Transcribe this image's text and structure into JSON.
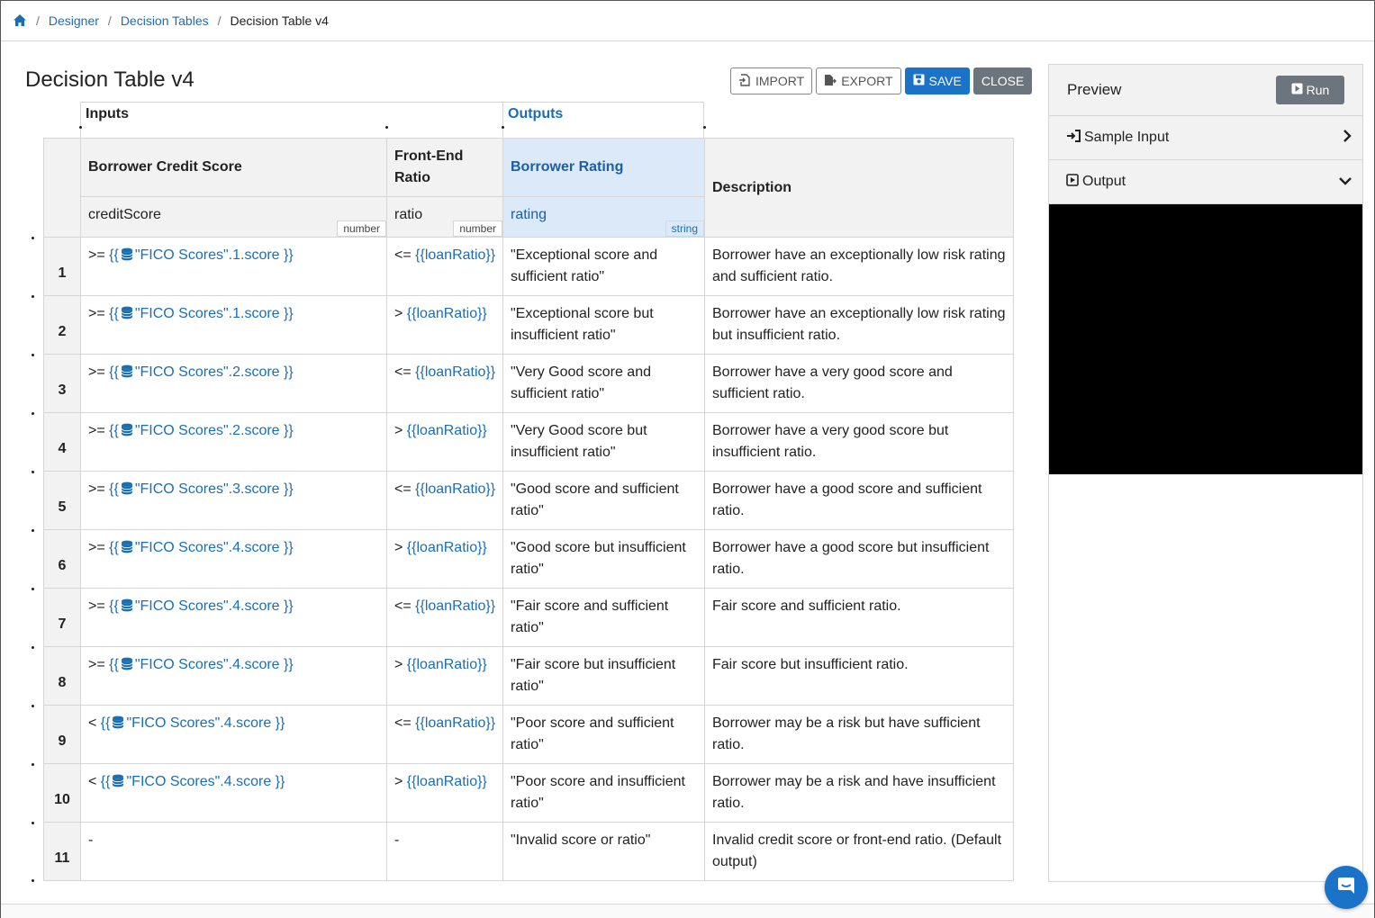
{
  "breadcrumb": {
    "items": [
      {
        "label": "Designer"
      },
      {
        "label": "Decision Tables"
      }
    ],
    "current": "Decision Table v4"
  },
  "page_title": "Decision Table v4",
  "toolbar": {
    "import_label": "IMPORT",
    "export_label": "EXPORT",
    "save_label": "SAVE",
    "close_label": "CLOSE"
  },
  "table": {
    "inputs_label": "Inputs",
    "outputs_label": "Outputs",
    "columns": [
      {
        "name": "Borrower Credit Score",
        "variable": "creditScore",
        "type": "number"
      },
      {
        "name": "Front-End Ratio",
        "variable": "ratio",
        "type": "number"
      },
      {
        "name": "Borrower Rating",
        "variable": "rating",
        "type": "string"
      }
    ],
    "description_label": "Description",
    "rows": [
      {
        "num": "1",
        "op1": ">= ",
        "ref1_open": "{{",
        "ref1_text": "\"FICO Scores\".1.score }}",
        "op2": "<= ",
        "ref2": "{{loanRatio}}",
        "rating": "\"Exceptional score and sufficient ratio\"",
        "desc": "Borrower have an exceptionally low risk rating and sufficient ratio."
      },
      {
        "num": "2",
        "op1": ">= ",
        "ref1_open": "{{",
        "ref1_text": "\"FICO Scores\".1.score }}",
        "op2": "> ",
        "ref2": "{{loanRatio}}",
        "rating": "\"Exceptional score but insufficient ratio\"",
        "desc": "Borrower have an exceptionally low risk rating but insufficient ratio."
      },
      {
        "num": "3",
        "op1": ">= ",
        "ref1_open": "{{",
        "ref1_text": "\"FICO Scores\".2.score }}",
        "op2": "<= ",
        "ref2": "{{loanRatio}}",
        "rating": "\"Very Good score and sufficient ratio\"",
        "desc": "Borrower have a very good score and sufficient ratio."
      },
      {
        "num": "4",
        "op1": ">= ",
        "ref1_open": "{{",
        "ref1_text": "\"FICO Scores\".2.score }}",
        "op2": "> ",
        "ref2": "{{loanRatio}}",
        "rating": "\"Very Good score but insufficient ratio\"",
        "desc": "Borrower have a very good score but insufficient ratio."
      },
      {
        "num": "5",
        "op1": ">= ",
        "ref1_open": "{{",
        "ref1_text": "\"FICO Scores\".3.score }}",
        "op2": "<= ",
        "ref2": "{{loanRatio}}",
        "rating": "\"Good score and sufficient ratio\"",
        "desc": "Borrower have a good score and sufficient ratio."
      },
      {
        "num": "6",
        "op1": ">= ",
        "ref1_open": "{{",
        "ref1_text": "\"FICO Scores\".4.score }}",
        "op2": "> ",
        "ref2": "{{loanRatio}}",
        "rating": "\"Good score but insufficient ratio\"",
        "desc": "Borrower have a good score but insufficient ratio."
      },
      {
        "num": "7",
        "op1": ">= ",
        "ref1_open": "{{",
        "ref1_text": "\"FICO Scores\".4.score }}",
        "op2": "<= ",
        "ref2": "{{loanRatio}}",
        "rating": "\"Fair score and sufficient ratio\"",
        "desc": "Fair score and sufficient ratio."
      },
      {
        "num": "8",
        "op1": ">= ",
        "ref1_open": "{{",
        "ref1_text": "\"FICO Scores\".4.score }}",
        "op2": "> ",
        "ref2": "{{loanRatio}}",
        "rating": "\"Fair score but insufficient ratio\"",
        "desc": "Fair score but insufficient ratio."
      },
      {
        "num": "9",
        "op1": "< ",
        "ref1_open": "{{",
        "ref1_text": "\"FICO Scores\".4.score }}",
        "op2": "<= ",
        "ref2": "{{loanRatio}}",
        "rating": "\"Poor score and sufficient ratio\"",
        "desc": "Borrower may be a risk but have sufficient ratio."
      },
      {
        "num": "10",
        "op1": "< ",
        "ref1_open": "{{",
        "ref1_text": "\"FICO Scores\".4.score }}",
        "op2": "> ",
        "ref2": "{{loanRatio}}",
        "rating": "\"Poor score and insufficient ratio\"",
        "desc": "Borrower may be a risk and have insufficient ratio."
      },
      {
        "num": "11",
        "op1": "-",
        "ref1_open": "",
        "ref1_text": "",
        "op2": "-",
        "ref2": "",
        "rating": "\"Invalid score or ratio\"",
        "desc": "Invalid credit score or front-end ratio. (Default output)"
      }
    ]
  },
  "preview": {
    "title": "Preview",
    "run_label": "Run",
    "sample_input_label": "Sample Input",
    "output_label": "Output"
  },
  "colors": {
    "link": "#1a6fb3",
    "primary": "#1a73c9",
    "secondary": "#6c757d",
    "output_highlight": "#dbe9f9"
  },
  "icons": [
    "home-icon",
    "import-icon",
    "export-icon",
    "save-icon",
    "database-icon",
    "run-icon",
    "sign-in-icon",
    "chevron-right-icon",
    "play-square-icon",
    "chevron-down-icon",
    "chat-icon"
  ]
}
